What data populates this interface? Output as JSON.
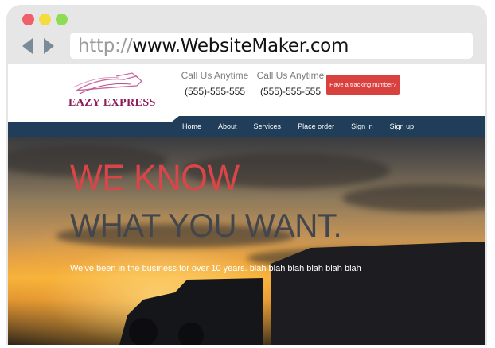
{
  "browser": {
    "url_protocol": "http://",
    "url_host": "www.WebsiteMaker.com"
  },
  "site": {
    "logo_text": "EAZY EXPRESS",
    "contacts": [
      {
        "label": "Call Us Anytime",
        "phone": "(555)-555-555"
      },
      {
        "label": "Call Us Anytime",
        "phone": "(555)-555-555"
      }
    ],
    "tracking_button": "Have a tracking number?",
    "menu": [
      "Home",
      "About",
      "Services",
      "Place order",
      "Sign in",
      "Sign up"
    ],
    "hero": {
      "line1": "WE KNOW",
      "line2": "WHAT YOU WANT.",
      "subtitle": "We've been in the business for over 10 years. blah blah blah blah blah blah"
    }
  },
  "colors": {
    "accent_red": "#d9413f",
    "navbar": "#203d5a",
    "logo": "#8c1c5a"
  }
}
